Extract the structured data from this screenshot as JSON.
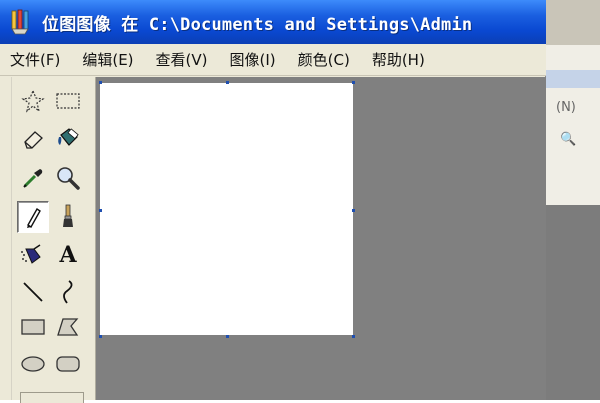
{
  "window": {
    "title": "位图图像 在 C:\\Documents and Settings\\Admin"
  },
  "menu": [
    {
      "label": "文件(F)"
    },
    {
      "label": "编辑(E)"
    },
    {
      "label": "查看(V)"
    },
    {
      "label": "图像(I)"
    },
    {
      "label": "颜色(C)"
    },
    {
      "label": "帮助(H)"
    }
  ],
  "tools": [
    {
      "icon": "free-select-icon"
    },
    {
      "icon": "rect-select-icon"
    },
    {
      "icon": "eraser-icon"
    },
    {
      "icon": "fill-bucket-icon"
    },
    {
      "icon": "color-picker-icon"
    },
    {
      "icon": "magnifier-icon"
    },
    {
      "icon": "pencil-icon",
      "selected": true
    },
    {
      "icon": "brush-icon"
    },
    {
      "icon": "airbrush-icon"
    },
    {
      "icon": "text-icon",
      "glyph": "A"
    },
    {
      "icon": "line-icon"
    },
    {
      "icon": "curve-icon"
    },
    {
      "icon": "rectangle-icon"
    },
    {
      "icon": "polygon-icon"
    },
    {
      "icon": "ellipse-icon"
    },
    {
      "icon": "rounded-rect-icon"
    }
  ],
  "colors": {
    "title_bar": "#0a48d1",
    "workspace": "#808080",
    "canvas": "#ffffff",
    "chrome": "#ece9d8"
  }
}
